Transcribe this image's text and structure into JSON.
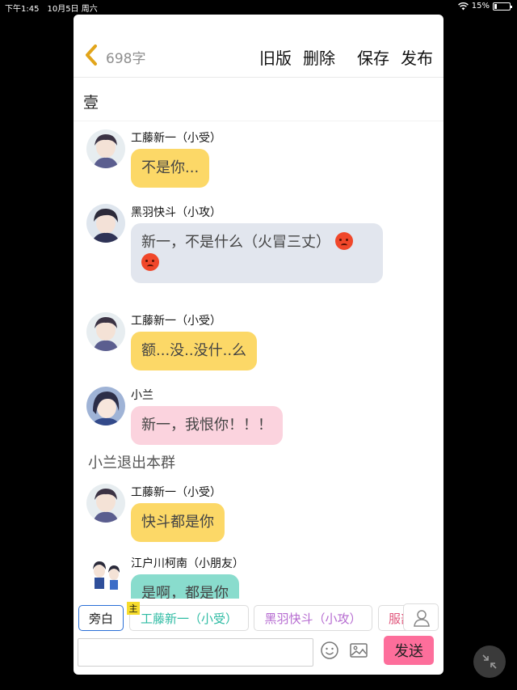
{
  "status_bar": {
    "time": "下午1:45",
    "date": "10月5日 周六",
    "battery": "15%",
    "battery_level": 0.15
  },
  "header": {
    "word_count": "698字",
    "actions": {
      "old_version": "旧版",
      "delete": "删除",
      "save": "保存",
      "publish": "发布"
    }
  },
  "chapter_title": "壹",
  "messages": [
    {
      "name": "工藤新一（小受）",
      "text": "不是你...",
      "color": "#fcd867"
    },
    {
      "name": "黑羽快斗（小攻）",
      "text_line1": "新一，不是什么（火冒三丈）",
      "color": "#e2e6ee",
      "emoji": "angry-face"
    },
    {
      "name": "工藤新一（小受）",
      "text": "额...没..没什..么",
      "color": "#fcd867"
    },
    {
      "name": "小兰",
      "text": "新一，我恨你！！！",
      "color": "#fbd3de"
    },
    {
      "name": "工藤新一（小受）",
      "text": "快斗都是你",
      "color": "#fcd867"
    },
    {
      "name": "江户川柯南（小朋友）",
      "text": "是啊，都是你",
      "color": "#89dccd"
    }
  ],
  "system_message": "小兰退出本群",
  "role_bar": {
    "narration": "旁白",
    "main_badge": "主",
    "roles": [
      "工藤新一（小受）",
      "黑羽快斗（小攻）",
      "服部"
    ]
  },
  "composer": {
    "input_value": "",
    "send_label": "发送"
  },
  "colors": {
    "accent_pink": "#fd6e9b",
    "role_teal": "#2dbba3",
    "role_purple": "#b56ad0",
    "role_pink": "#e0547a",
    "back_arrow": "#e2a51b"
  }
}
